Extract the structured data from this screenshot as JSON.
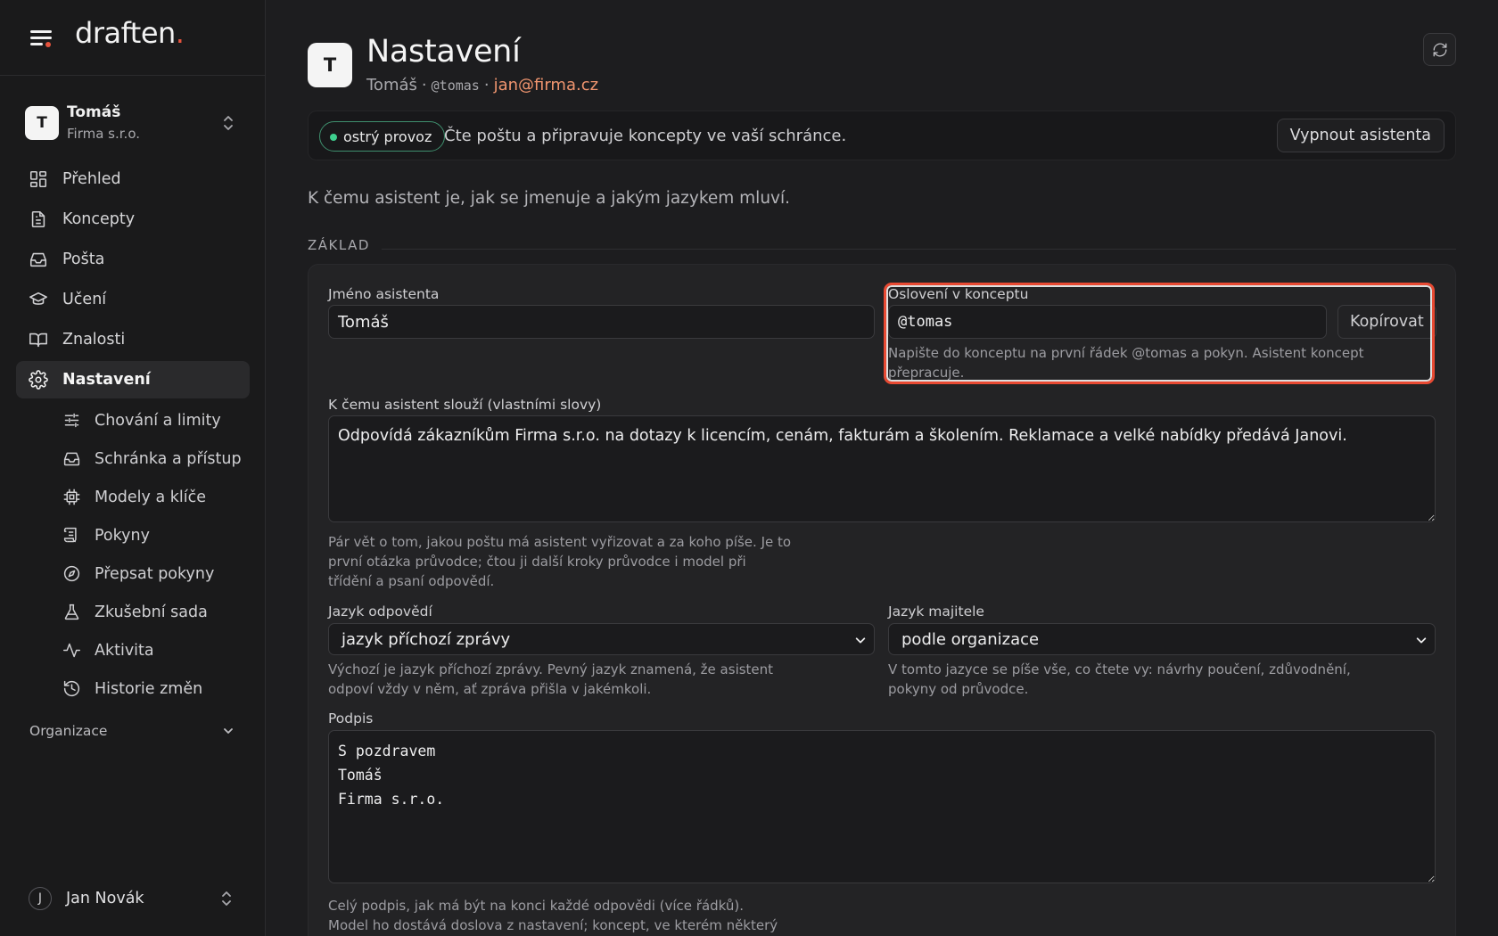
{
  "brand": {
    "name": "draften",
    "dot": "."
  },
  "account": {
    "initial": "T",
    "name": "Tomáš",
    "org": "Firma s.r.o."
  },
  "nav": {
    "items": [
      {
        "label": "Přehled",
        "icon": "grid-icon"
      },
      {
        "label": "Koncepty",
        "icon": "document-icon"
      },
      {
        "label": "Pošta",
        "icon": "inbox-icon"
      },
      {
        "label": "Učení",
        "icon": "graduation-cap-icon"
      },
      {
        "label": "Znalosti",
        "icon": "book-icon"
      },
      {
        "label": "Nastavení",
        "icon": "gear-icon",
        "active": true
      }
    ],
    "sub": [
      {
        "label": "Chování a limity",
        "icon": "sliders-icon"
      },
      {
        "label": "Schránka a přístup",
        "icon": "inbox-icon"
      },
      {
        "label": "Modely a klíče",
        "icon": "chip-icon"
      },
      {
        "label": "Pokyny",
        "icon": "scroll-icon"
      },
      {
        "label": "Přepsat pokyny",
        "icon": "compass-icon"
      },
      {
        "label": "Zkušební sada",
        "icon": "flask-icon"
      },
      {
        "label": "Aktivita",
        "icon": "activity-icon"
      },
      {
        "label": "Historie změn",
        "icon": "history-icon"
      }
    ],
    "org_label": "Organizace"
  },
  "user": {
    "initial": "J",
    "name": "Jan Novák"
  },
  "header": {
    "initial": "T",
    "title": "Nastavení",
    "name": "Tomáš",
    "handle": "@tomas",
    "email": "jan@firma.cz",
    "sep": "·"
  },
  "status": {
    "badge": "ostrý provoz",
    "text": "Čte poštu a připravuje koncepty ve vaší schránce.",
    "button": "Vypnout asistenta",
    "accent": "#3ecf8e"
  },
  "intro": "K čemu asistent je, jak se jmenuje a jakým jazykem mluví.",
  "section": "ZÁKLAD",
  "form": {
    "name_label": "Jméno asistenta",
    "name_value": "Tomáš",
    "salutation_label": "Oslovení v konceptu",
    "salutation_value": "@tomas",
    "copy_button": "Kopírovat",
    "salutation_help": "Napište do konceptu na první řádek @tomas a pokyn. Asistent koncept přepracuje.",
    "purpose_label": "K čemu asistent slouží (vlastními slovy)",
    "purpose_value": "Odpovídá zákazníkům Firma s.r.o. na dotazy k licencím, cenám, fakturám a školením. Reklamace a velké nabídky předává Janovi.",
    "purpose_help": "Pár vět o tom, jakou poštu má asistent vyřizovat a za koho píše. Je to první otázka průvodce; čtou ji další kroky průvodce i model při třídění a psaní odpovědí.",
    "reply_lang_label": "Jazyk odpovědí",
    "reply_lang_value": "jazyk příchozí zprávy",
    "reply_lang_help": "Výchozí je jazyk příchozí zprávy. Pevný jazyk znamená, že asistent odpoví vždy v něm, ať zpráva přišla v jakémkoli.",
    "owner_lang_label": "Jazyk majitele",
    "owner_lang_value": "podle organizace",
    "owner_lang_help": "V tomto jazyce se píše vše, co čtete vy: návrhy poučení, zdůvodnění, pokyny od průvodce.",
    "signature_label": "Podpis",
    "signature_value": "S pozdravem\nTomáš\nFirma s.r.o.",
    "signature_help": "Celý podpis, jak má být na konci každé odpovědi (více řádků). Model ho dostává doslova z nastavení; koncept, ve kterém některý řádek"
  },
  "colors": {
    "highlight": "#e84a33",
    "email": "#f0956f",
    "logo_dot": "#e5533d"
  }
}
